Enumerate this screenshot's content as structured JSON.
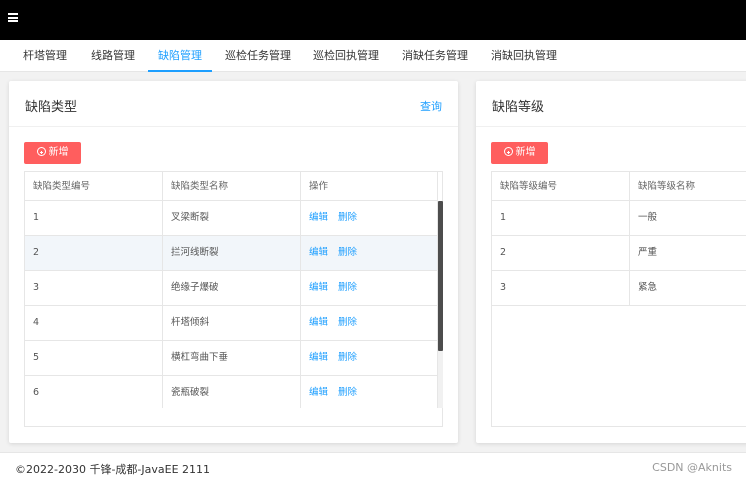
{
  "nav": {
    "tabs": [
      {
        "label": "杆塔管理",
        "active": false
      },
      {
        "label": "线路管理",
        "active": false
      },
      {
        "label": "缺陷管理",
        "active": true
      },
      {
        "label": "巡检任务管理",
        "active": false
      },
      {
        "label": "巡检回执管理",
        "active": false
      },
      {
        "label": "消缺任务管理",
        "active": false
      },
      {
        "label": "消缺回执管理",
        "active": false
      }
    ]
  },
  "defect_type_panel": {
    "title": "缺陷类型",
    "query_label": "查询",
    "add_label": "新增",
    "columns": [
      "缺陷类型编号",
      "缺陷类型名称",
      "操作"
    ],
    "edit_label": "编辑",
    "delete_label": "删除",
    "rows": [
      {
        "id": "1",
        "name": "叉梁断裂"
      },
      {
        "id": "2",
        "name": "拦河线断裂"
      },
      {
        "id": "3",
        "name": "绝缘子爆破"
      },
      {
        "id": "4",
        "name": "杆塔倾斜"
      },
      {
        "id": "5",
        "name": "横杠弯曲下垂"
      },
      {
        "id": "6",
        "name": "瓷瓶破裂"
      }
    ]
  },
  "defect_level_panel": {
    "title": "缺陷等级",
    "add_label": "新增",
    "columns": [
      "缺陷等级编号",
      "缺陷等级名称"
    ],
    "rows": [
      {
        "id": "1",
        "name": "一般"
      },
      {
        "id": "2",
        "name": "严重"
      },
      {
        "id": "3",
        "name": "紧急"
      }
    ]
  },
  "footer": {
    "copyright": "©2022-2030 千锋-成都-JavaEE 2111",
    "watermark": "CSDN @Aknits"
  },
  "colors": {
    "accent": "#1e9fff",
    "danger_button": "#ff5e5e",
    "topbar": "#000000"
  }
}
